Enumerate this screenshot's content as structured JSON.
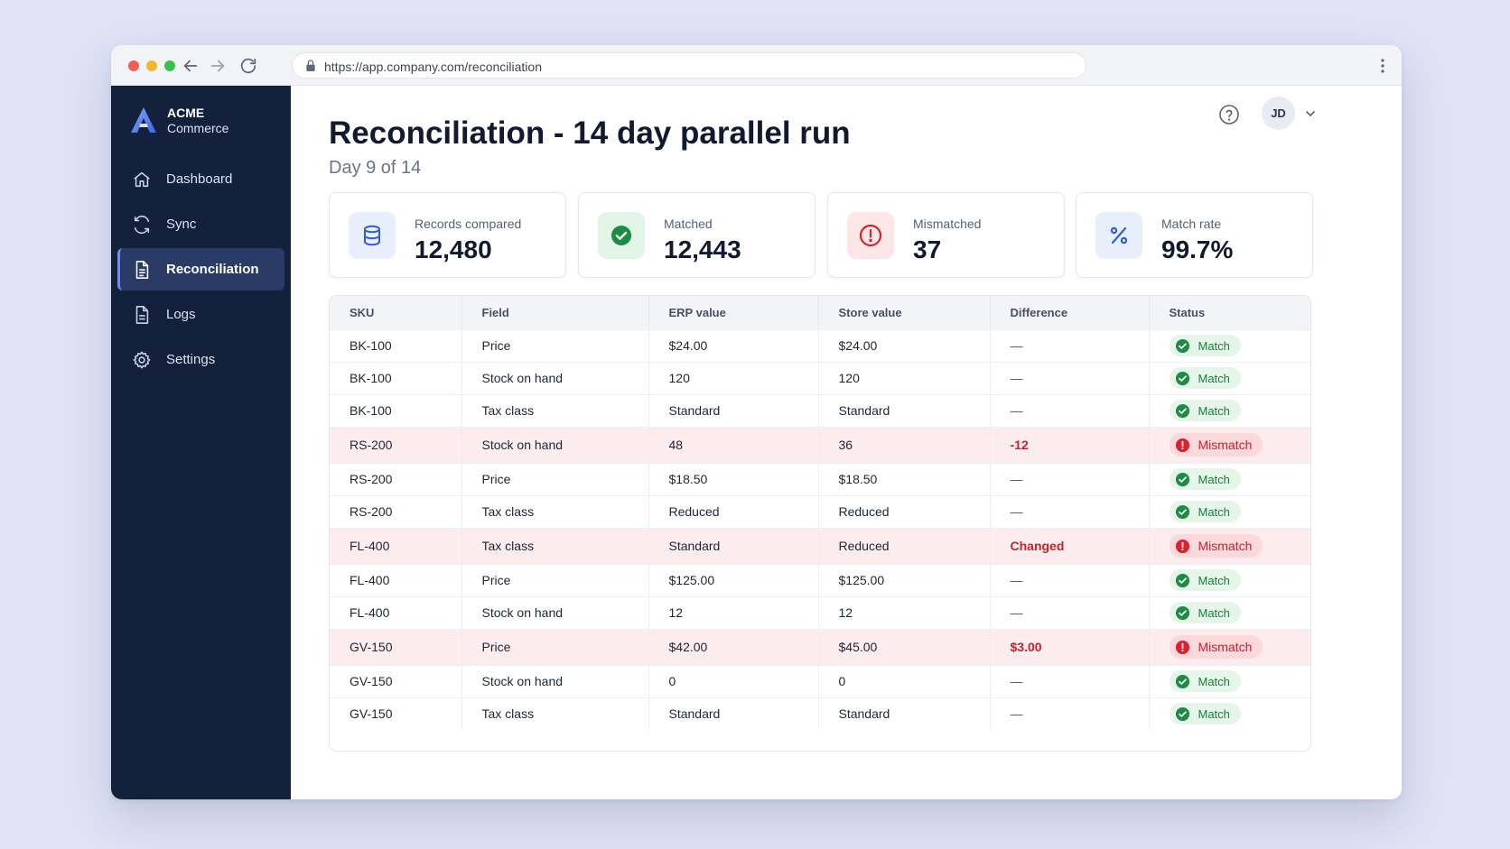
{
  "browser": {
    "url": "https://app.company.com/reconciliation"
  },
  "brand": {
    "line1": "ACME",
    "line2": "Commerce"
  },
  "sidebar": {
    "items": [
      {
        "label": "Dashboard",
        "icon": "home-icon",
        "active": false
      },
      {
        "label": "Sync",
        "icon": "sync-icon",
        "active": false
      },
      {
        "label": "Reconciliation",
        "icon": "document-icon",
        "active": true
      },
      {
        "label": "Logs",
        "icon": "log-icon",
        "active": false
      },
      {
        "label": "Settings",
        "icon": "gear-icon",
        "active": false
      }
    ]
  },
  "header": {
    "title": "Reconciliation - 14 day parallel run",
    "subtitle": "Day 9 of 14",
    "avatar_initials": "JD"
  },
  "stats": [
    {
      "label": "Records compared",
      "value": "12,480",
      "icon": "database-icon",
      "color": "#2f5fd0",
      "bg": "#e8eefc"
    },
    {
      "label": "Matched",
      "value": "12,443",
      "icon": "check-circle-icon",
      "color": "#1e8a45",
      "bg": "#e2f4e8"
    },
    {
      "label": "Mismatched",
      "value": "37",
      "icon": "alert-circle-icon",
      "color": "#d3242f",
      "bg": "#fde6e8"
    },
    {
      "label": "Match rate",
      "value": "99.7%",
      "icon": "percent-icon",
      "color": "#2f5fd0",
      "bg": "#e8eefc"
    }
  ],
  "table": {
    "headers": [
      "SKU",
      "Field",
      "ERP value",
      "Store value",
      "Difference",
      "Status"
    ],
    "rows": [
      {
        "sku": "BK-100",
        "field": "Price",
        "erp": "$24.00",
        "store": "$24.00",
        "diff": "—",
        "status": "Match"
      },
      {
        "sku": "BK-100",
        "field": "Stock on hand",
        "erp": "120",
        "store": "120",
        "diff": "—",
        "status": "Match"
      },
      {
        "sku": "BK-100",
        "field": "Tax class",
        "erp": "Standard",
        "store": "Standard",
        "diff": "—",
        "status": "Match"
      },
      {
        "sku": "RS-200",
        "field": "Stock on hand",
        "erp": "48",
        "store": "36",
        "diff": "-12",
        "status": "Mismatch"
      },
      {
        "sku": "RS-200",
        "field": "Price",
        "erp": "$18.50",
        "store": "$18.50",
        "diff": "—",
        "status": "Match"
      },
      {
        "sku": "RS-200",
        "field": "Tax class",
        "erp": "Reduced",
        "store": "Reduced",
        "diff": "—",
        "status": "Match"
      },
      {
        "sku": "FL-400",
        "field": "Tax class",
        "erp": "Standard",
        "store": "Reduced",
        "diff": "Changed",
        "status": "Mismatch"
      },
      {
        "sku": "FL-400",
        "field": "Price",
        "erp": "$125.00",
        "store": "$125.00",
        "diff": "—",
        "status": "Match"
      },
      {
        "sku": "FL-400",
        "field": "Stock on hand",
        "erp": "12",
        "store": "12",
        "diff": "—",
        "status": "Match"
      },
      {
        "sku": "GV-150",
        "field": "Price",
        "erp": "$42.00",
        "store": "$45.00",
        "diff": "$3.00",
        "status": "Mismatch"
      },
      {
        "sku": "GV-150",
        "field": "Stock on hand",
        "erp": "0",
        "store": "0",
        "diff": "—",
        "status": "Match"
      },
      {
        "sku": "GV-150",
        "field": "Tax class",
        "erp": "Standard",
        "store": "Standard",
        "diff": "—",
        "status": "Match"
      }
    ]
  },
  "colors": {
    "sidebar_bg": "#14213d",
    "match_green": "#1e8a45",
    "mismatch_red": "#c8202c"
  }
}
